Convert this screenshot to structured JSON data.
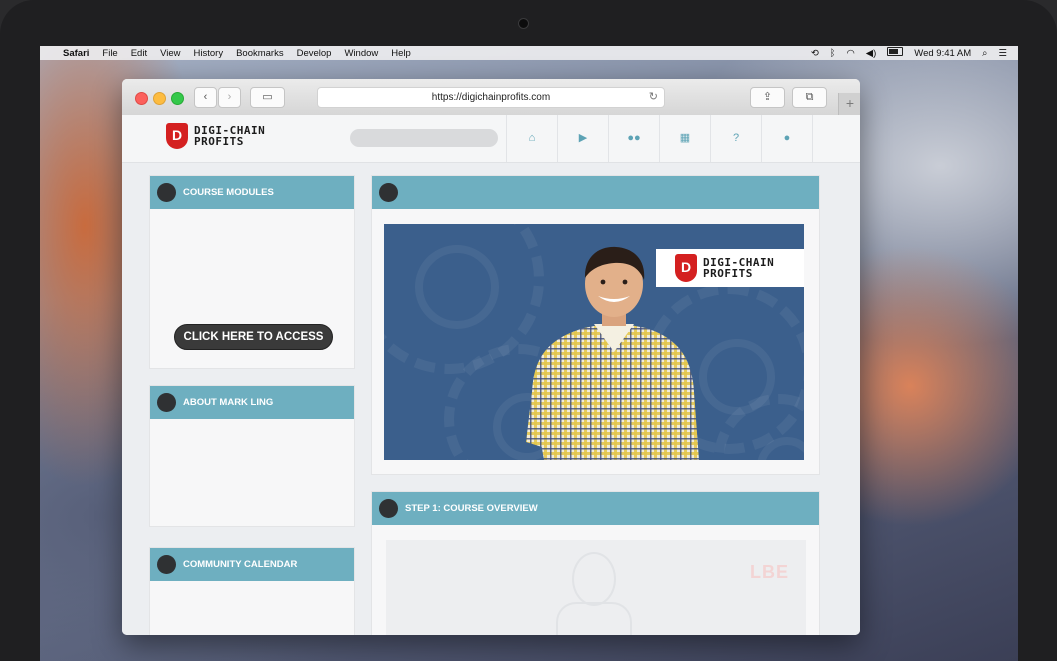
{
  "menubar": {
    "app_name": "Safari",
    "items": [
      "File",
      "Edit",
      "View",
      "History",
      "Bookmarks",
      "Develop",
      "Window",
      "Help"
    ],
    "clock": "Wed 9:41 AM"
  },
  "browser": {
    "url": "https://digichainprofits.com"
  },
  "site": {
    "logo_line1": "DIGI-CHAIN",
    "logo_line2": "PROFITS",
    "logo_letter": "D",
    "nav_icons": [
      "home-icon",
      "play-icon",
      "users-icon",
      "calendar-icon",
      "help-icon",
      "user-icon"
    ],
    "accent_color": "#6eafc0"
  },
  "sidebar": {
    "course_modules_title": "COURSE MODULES",
    "cta_label": "CLICK HERE TO ACCESS",
    "about_title": "ABOUT MARK LING",
    "calendar_title": "COMMUNITY CALENDAR"
  },
  "main": {
    "video_panel_title": "",
    "video_brand_line1": "DIGI-CHAIN",
    "video_brand_line2": "PROFITS",
    "step1_title": "STEP 1: COURSE OVERVIEW",
    "step1_thumb_text": "LBE"
  }
}
